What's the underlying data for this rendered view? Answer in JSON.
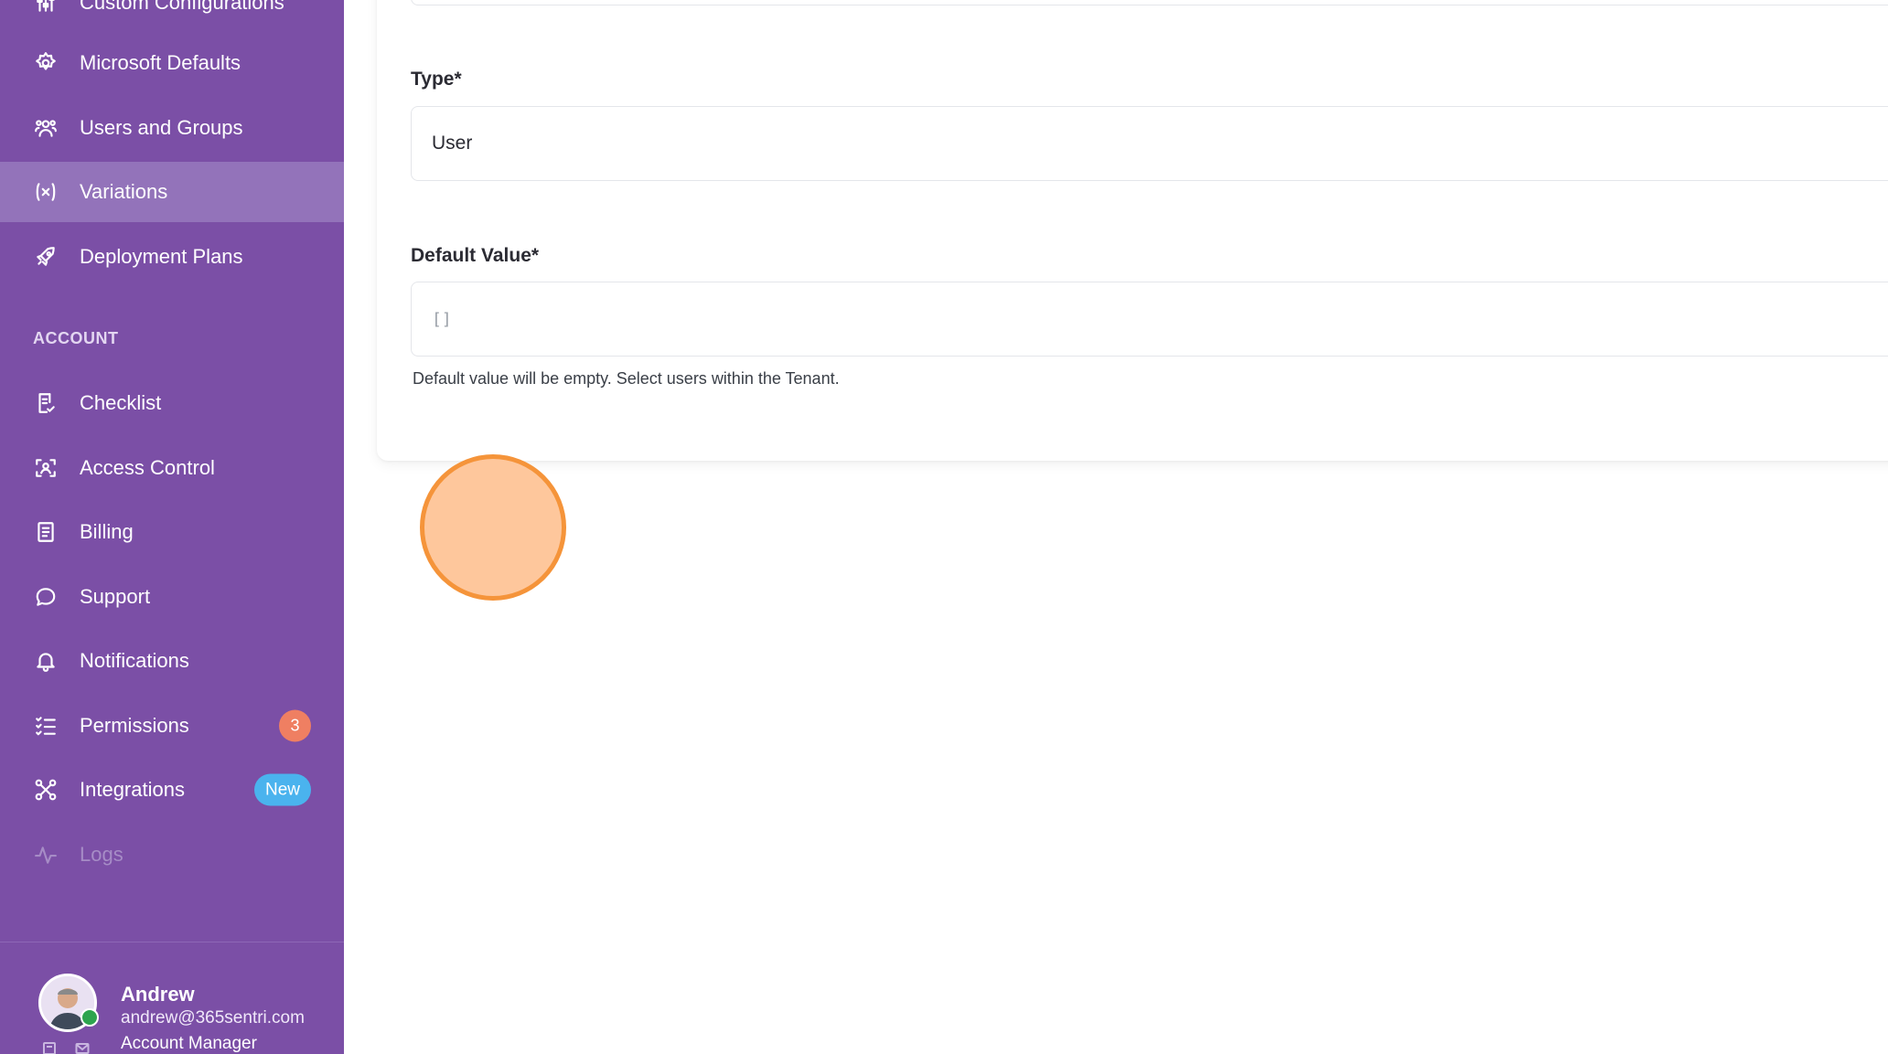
{
  "sidebar": {
    "items_top": [
      {
        "label": "Custom Configurations",
        "icon": "sliders-icon"
      },
      {
        "label": "Microsoft Defaults",
        "icon": "gear-icon"
      },
      {
        "label": "Users and Groups",
        "icon": "users-icon"
      },
      {
        "label": "Variations",
        "icon": "variable-icon",
        "active": true
      },
      {
        "label": "Deployment Plans",
        "icon": "rocket-icon"
      }
    ],
    "section_label": "ACCOUNT",
    "items_account": [
      {
        "label": "Checklist",
        "icon": "checklist-icon"
      },
      {
        "label": "Access Control",
        "icon": "scan-face-icon"
      },
      {
        "label": "Billing",
        "icon": "receipt-icon"
      },
      {
        "label": "Support",
        "icon": "chat-bubble-icon"
      },
      {
        "label": "Notifications",
        "icon": "bell-icon"
      },
      {
        "label": "Permissions",
        "icon": "list-check-icon",
        "badge": "3"
      },
      {
        "label": "Integrations",
        "icon": "integrations-icon",
        "badge": "New"
      },
      {
        "label": "Logs",
        "icon": "activity-icon",
        "disabled": true
      }
    ]
  },
  "profile": {
    "name": "Andrew",
    "email": "andrew@365sentri.com",
    "role": "Account Manager"
  },
  "form": {
    "type_label": "Type*",
    "type_value": "User",
    "default_label": "Default Value*",
    "default_placeholder": "[]",
    "helper_text": "Default value will be empty. Select users within the Tenant."
  },
  "colors": {
    "sidebar_bg": "#7b4fa6",
    "sidebar_active": "#9373ba",
    "badge_count": "#ef7f62",
    "badge_new": "#4ab3ee",
    "click_marker_fill": "#fec79c",
    "click_marker_border": "#f5943a"
  }
}
